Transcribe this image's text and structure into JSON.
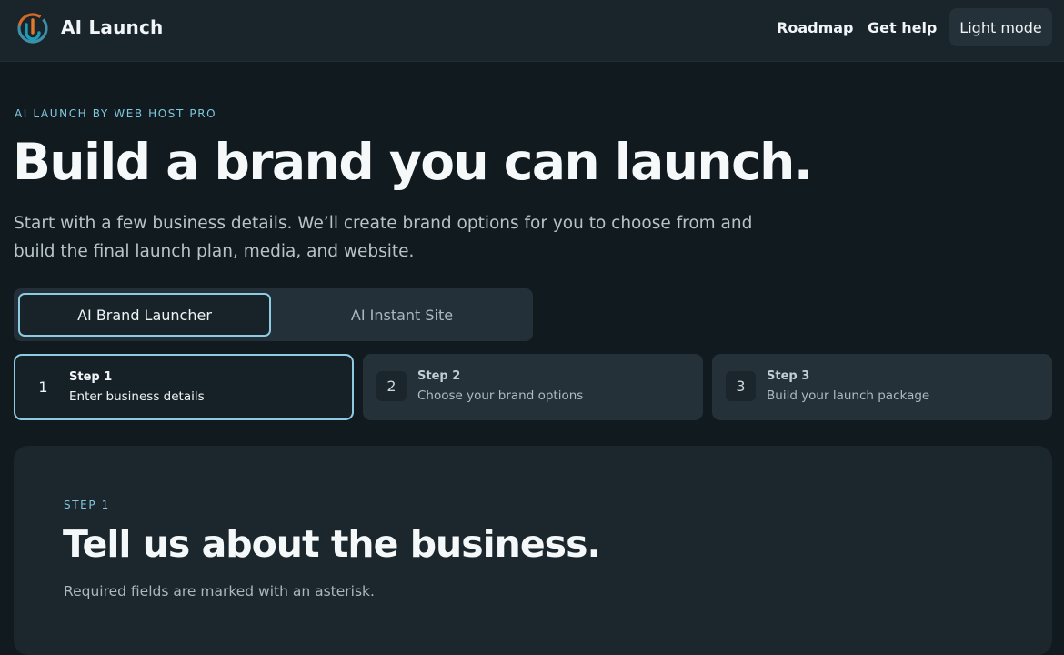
{
  "header": {
    "app_title": "AI Launch",
    "logo_icon": "ai-launch-logo-icon",
    "nav": {
      "roadmap": "Roadmap",
      "get_help": "Get help",
      "mode_toggle": "Light mode"
    }
  },
  "hero": {
    "eyebrow": "AI LAUNCH BY WEB HOST PRO",
    "title": "Build a brand you can launch.",
    "subtitle": "Start with a few business details. We’ll create brand options for you to choose from and build the final launch plan, media, and website."
  },
  "tabs": [
    {
      "label": "AI Brand Launcher",
      "active": true
    },
    {
      "label": "AI Instant Site",
      "active": false
    }
  ],
  "steps": [
    {
      "number": "1",
      "label": "Step 1",
      "description": "Enter business details",
      "active": true
    },
    {
      "number": "2",
      "label": "Step 2",
      "description": "Choose your brand options",
      "active": false
    },
    {
      "number": "3",
      "label": "Step 3",
      "description": "Build your launch package",
      "active": false
    }
  ],
  "panel": {
    "eyebrow": "STEP 1",
    "title": "Tell us about the business.",
    "note": "Required fields are marked with an asterisk."
  },
  "colors": {
    "accent": "#8ccbe2",
    "eyebrow": "#7fc7df",
    "background": "#111a1f",
    "surface": "#243139"
  }
}
